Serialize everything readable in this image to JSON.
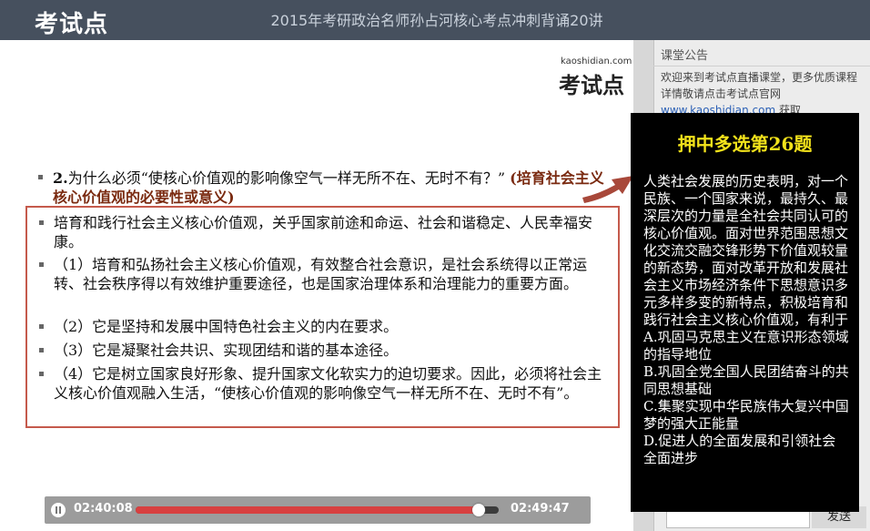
{
  "header": {
    "logo": "考试点",
    "title": "2015年考研政治名师孙占河核心考点冲刺背诵20讲"
  },
  "slide": {
    "brand_small": "kaoshidian.com",
    "brand_big": "考试点",
    "question_num": "2.",
    "question": "为什么必须“使核心价值观的影响像空气一样无所不在、无时不有？”",
    "question_note": "(培育社会主义核心价值观的必要性或意义)",
    "answers": [
      "培育和践行社会主义核心价值观，关乎国家前途和命运、社会和谐稳定、人民幸福安康。",
      "（1）培育和弘扬社会主义核心价值观，有效整合社会意识，是社会系统得以正常运转、社会秩序得以有效维护重要途径，也是国家治理体系和治理能力的重要方面。",
      "（2）它是坚持和发展中国特色社会主义的内在要求。",
      "（3）它是凝聚社会共识、实现团结和谐的基本途径。",
      "（4）它是树立国家良好形象、提升国家文化软实力的迫切要求。因此，必须将社会主义核心价值观融入生活，“使核心价值观的影响像空气一样无所不在、无时不有”。"
    ]
  },
  "player": {
    "current_time": "02:40:08",
    "total_time": "02:49:47",
    "progress": 0.945
  },
  "sidebar": {
    "notice_title": "课堂公告",
    "notice_text": "欢迎来到考试点直播课堂，更多优质课程详情敬请点击考试点官网",
    "notice_link": "www.kaoshidian.com",
    "notice_suffix": " 获取",
    "send_label": "发送"
  },
  "overlay": {
    "title": "押中多选第26题",
    "body": "人类社会发展的历史表明，对一个民族、一个国家来说，最持久、最深层次的力量是全社会共同认可的核心价值观。面对世界范围思想文化交流交融交锋形势下价值观较量的新态势，面对改革开放和发展社会主义市场经济条件下思想意识多元多样多变的新特点，积极培育和践行社会主义核心价值观，有利于\nA.巩固马克思主义在意识形态领域的指导地位\nB.巩固全党全国人民团结奋斗的共同思想基础\nC.集聚实现中华民族伟大复兴中国梦的强大正能量\nD.促进人的全面发展和引领社会全面进步"
  },
  "colors": {
    "header_bg": "#46505e",
    "box_border": "#c55a4c",
    "overlay_title": "#f2e21b",
    "progress_fill": "#d84040"
  }
}
